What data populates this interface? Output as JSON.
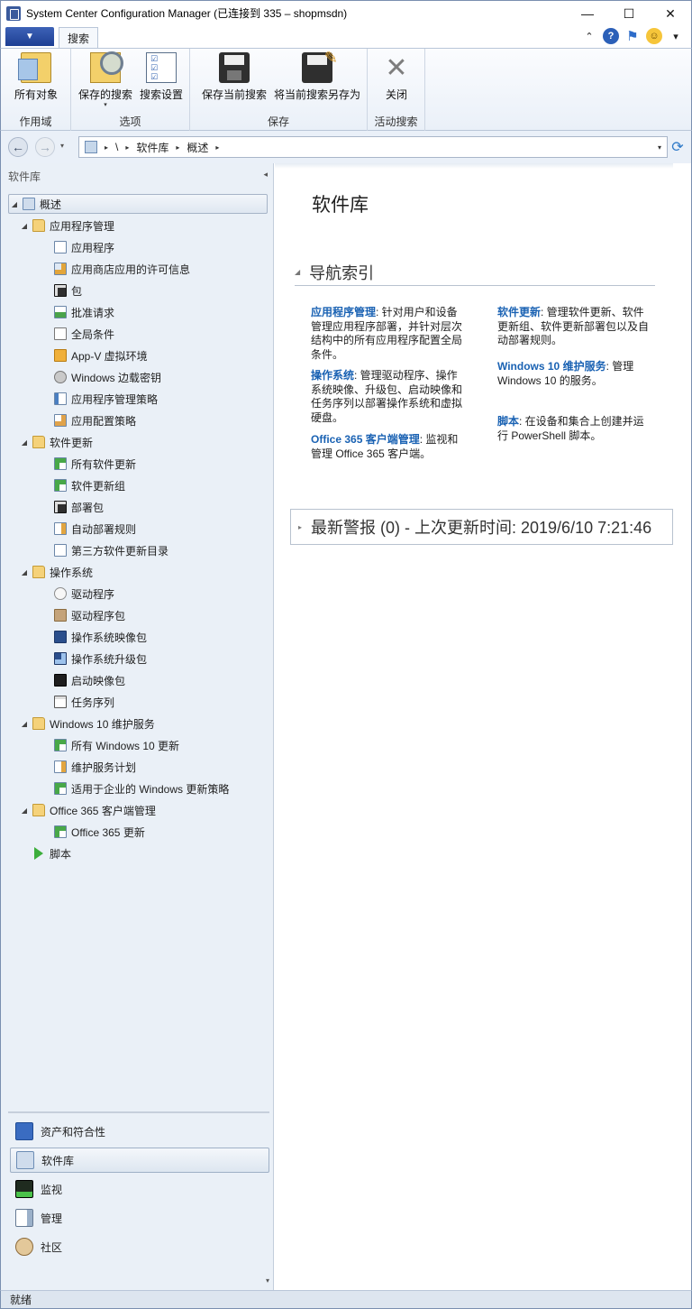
{
  "window": {
    "title": "System Center Configuration Manager (已连接到 335 – shopmsdn)",
    "minimize": "—",
    "maximize": "☐",
    "close": "✕"
  },
  "ribbon": {
    "file_menu_glyph": "▼",
    "active_tab": "搜索",
    "top_right": {
      "collapse": "⌃",
      "help": "?",
      "flag": "⚑",
      "smiley": "☺",
      "smiley_drop": "▾"
    },
    "groups": [
      {
        "label": "作用域",
        "buttons": [
          {
            "label": "所有对象",
            "icon": "all-objects-icon"
          }
        ]
      },
      {
        "label": "选项",
        "buttons": [
          {
            "label": "保存的搜索",
            "icon": "saved-search-icon",
            "has_dropdown": true
          },
          {
            "label": "搜索设置",
            "icon": "search-settings-icon"
          }
        ]
      },
      {
        "label": "保存",
        "buttons": [
          {
            "label": "保存当前搜索",
            "icon": "save-icon"
          },
          {
            "label": "将当前搜索另存为",
            "icon": "save-as-icon"
          }
        ]
      },
      {
        "label": "活动搜索",
        "buttons": [
          {
            "label": "关闭",
            "icon": "close-x-icon"
          }
        ]
      }
    ]
  },
  "address": {
    "back": "←",
    "forward": "→",
    "dropdown": "▾",
    "path": [
      "\\",
      "软件库",
      "概述"
    ],
    "separator": "▸",
    "refresh": "⟳"
  },
  "left_pane": {
    "header": "软件库",
    "collapse_glyph": "◂",
    "expanded_glyph": "◢",
    "tree": [
      {
        "label": "概述",
        "icon": "overview",
        "level": 0,
        "expanded": true,
        "selected": true
      },
      {
        "label": "应用程序管理",
        "icon": "folder",
        "level": 1,
        "expanded": true
      },
      {
        "label": "应用程序",
        "icon": "app",
        "level": 2
      },
      {
        "label": "应用商店应用的许可信息",
        "icon": "lic",
        "level": 2
      },
      {
        "label": "包",
        "icon": "pkg",
        "level": 2
      },
      {
        "label": "批准请求",
        "icon": "approve",
        "level": 2
      },
      {
        "label": "全局条件",
        "icon": "cond",
        "level": 2
      },
      {
        "label": "App-V 虚拟环境",
        "icon": "appv",
        "level": 2
      },
      {
        "label": "Windows 边载密钥",
        "icon": "key",
        "level": 2
      },
      {
        "label": "应用程序管理策略",
        "icon": "policy",
        "level": 2
      },
      {
        "label": "应用配置策略",
        "icon": "cfg",
        "level": 2
      },
      {
        "label": "软件更新",
        "icon": "folder",
        "level": 1,
        "expanded": true
      },
      {
        "label": "所有软件更新",
        "icon": "upd",
        "level": 2
      },
      {
        "label": "软件更新组",
        "icon": "upd",
        "level": 2
      },
      {
        "label": "部署包",
        "icon": "pkg",
        "level": 2
      },
      {
        "label": "自动部署规则",
        "icon": "rule",
        "level": 2
      },
      {
        "label": "第三方软件更新目录",
        "icon": "doc",
        "level": 2
      },
      {
        "label": "操作系统",
        "icon": "folder",
        "level": 1,
        "expanded": true
      },
      {
        "label": "驱动程序",
        "icon": "drv",
        "level": 2
      },
      {
        "label": "驱动程序包",
        "icon": "drvpkg",
        "level": 2
      },
      {
        "label": "操作系统映像包",
        "icon": "osimg",
        "level": 2
      },
      {
        "label": "操作系统升级包",
        "icon": "osup",
        "level": 2
      },
      {
        "label": "启动映像包",
        "icon": "boot",
        "level": 2
      },
      {
        "label": "任务序列",
        "icon": "ts",
        "level": 2
      },
      {
        "label": "Windows 10 维护服务",
        "icon": "folder",
        "level": 1,
        "expanded": true
      },
      {
        "label": "所有 Windows 10 更新",
        "icon": "upd",
        "level": 2
      },
      {
        "label": "维护服务计划",
        "icon": "rule",
        "level": 2
      },
      {
        "label": "适用于企业的 Windows 更新策略",
        "icon": "upd",
        "level": 2
      },
      {
        "label": "Office 365 客户端管理",
        "icon": "folder",
        "level": 1,
        "expanded": true
      },
      {
        "label": "Office 365 更新",
        "icon": "upd",
        "level": 2
      },
      {
        "label": "脚本",
        "icon": "script",
        "level": 1
      }
    ],
    "workspaces": [
      {
        "label": "资产和符合性",
        "icon": "asset"
      },
      {
        "label": "软件库",
        "icon": "lib",
        "selected": true
      },
      {
        "label": "监视",
        "icon": "mon"
      },
      {
        "label": "管理",
        "icon": "admin"
      },
      {
        "label": "社区",
        "icon": "comm"
      }
    ],
    "ws_scroll_glyph": "▾"
  },
  "main": {
    "title": "软件库",
    "nav_index": {
      "caret": "◢",
      "title": "导航索引"
    },
    "entries": [
      {
        "link": "应用程序管理",
        "text": ": 针对用户和设备\n管理应用程序部署，并针对层次\n结构中的所有应用程序配置全局\n条件。"
      },
      {
        "link": "操作系统",
        "text": ": 管理驱动程序、操作\n系统映像、升级包、启动映像和\n任务序列以部署操作系统和虚拟\n硬盘。"
      },
      {
        "link": "Office 365 客户端管理",
        "text": ": 监视和\n管理 Office 365 客户端。"
      },
      {
        "link": "软件更新",
        "text": ": 管理软件更新、软件\n更新组、软件更新部署包以及自\n动部署规则。"
      },
      {
        "link": "Windows 10 维护服务",
        "text": ": 管理\nWindows 10 的服务。"
      },
      {
        "link": "脚本",
        "text": ": 在设备和集合上创建并运\n行 PowerShell 脚本。"
      }
    ],
    "alerts": {
      "caret": "▸",
      "title": "最新警报 (0) - 上次更新时间: 2019/6/10 7:21:46"
    }
  },
  "status": {
    "text": "就绪"
  }
}
